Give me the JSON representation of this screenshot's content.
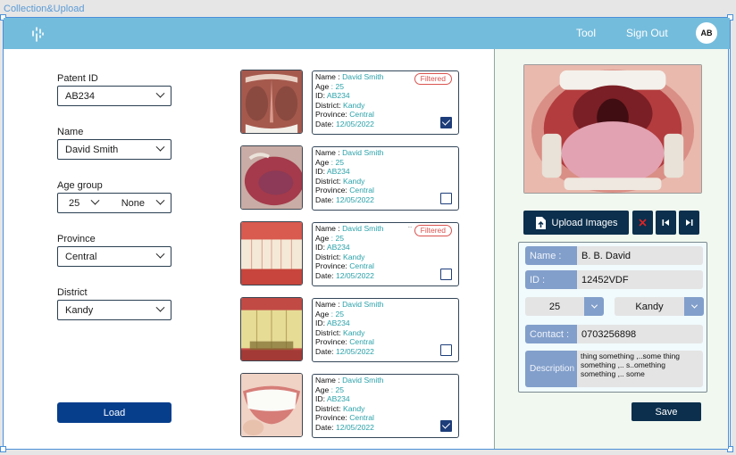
{
  "frame": {
    "title": "Collection&Upload"
  },
  "topbar": {
    "nav": [
      {
        "label": "Tool"
      },
      {
        "label": "Sign Out"
      }
    ],
    "avatar_initials": "AB"
  },
  "filters": {
    "patient_id": {
      "label": "Patent ID",
      "value": "AB234"
    },
    "name": {
      "label": "Name",
      "value": "David Smith"
    },
    "age_group": {
      "label": "Age group",
      "value_from": "25",
      "value_to": "None"
    },
    "province": {
      "label": "Province",
      "value": "Central"
    },
    "district": {
      "label": "District",
      "value": "Kandy"
    },
    "load_label": "Load"
  },
  "card_labels": {
    "name": "Name  : ",
    "age": "Age",
    "id": "ID: ",
    "district": "District: ",
    "province": "Province: ",
    "date": "Date: "
  },
  "results": [
    {
      "image": "palate",
      "name": "David Smith",
      "age": " : 25",
      "id": "AB234",
      "district": "Kandy",
      "province": "Central",
      "date": "12/05/2022",
      "badge": "Filtered",
      "checked": true
    },
    {
      "image": "tongue",
      "name": "David Smith",
      "age": " : 25",
      "id": "AB234",
      "district": "Kandy",
      "province": "Central",
      "date": "12/05/2022",
      "badge": "",
      "checked": false
    },
    {
      "image": "gums",
      "name": "David Smith",
      "age": " : 25",
      "id": "AB234",
      "district": "Kandy",
      "province": "Central",
      "date": "12/05/2022",
      "badge": "Filtered",
      "checked": false
    },
    {
      "image": "stained-teeth",
      "name": "David Smith",
      "age": " : 25",
      "id": "AB234",
      "district": "Kandy",
      "province": "Central",
      "date": "12/05/2022",
      "badge": "",
      "checked": false
    },
    {
      "image": "smile",
      "name": "David Smith",
      "age": " : 25",
      "id": "AB234",
      "district": "Kandy",
      "province": "Central",
      "date": "12/05/2022",
      "badge": "",
      "checked": true
    }
  ],
  "upload": {
    "preview_image": "open-mouth-throat",
    "upload_label": "Upload Images",
    "icons": {
      "upload": "file-upload-icon",
      "delete": "close-icon",
      "prev": "skip-previous-icon",
      "next": "skip-next-icon"
    },
    "accent_delete": "#e02424"
  },
  "form": {
    "name_label": "Name :",
    "name_value": "B. B. David",
    "id_label": "ID  :",
    "id_value": "12452VDF",
    "age_value": "25",
    "district_value": "Kandy",
    "contact_label": "Contact :",
    "contact_value": "0703256898",
    "description_label": "Description",
    "description_value": "thing something ,..some thing something ,.. s..omething something ,.. some",
    "save_label": "Save"
  }
}
